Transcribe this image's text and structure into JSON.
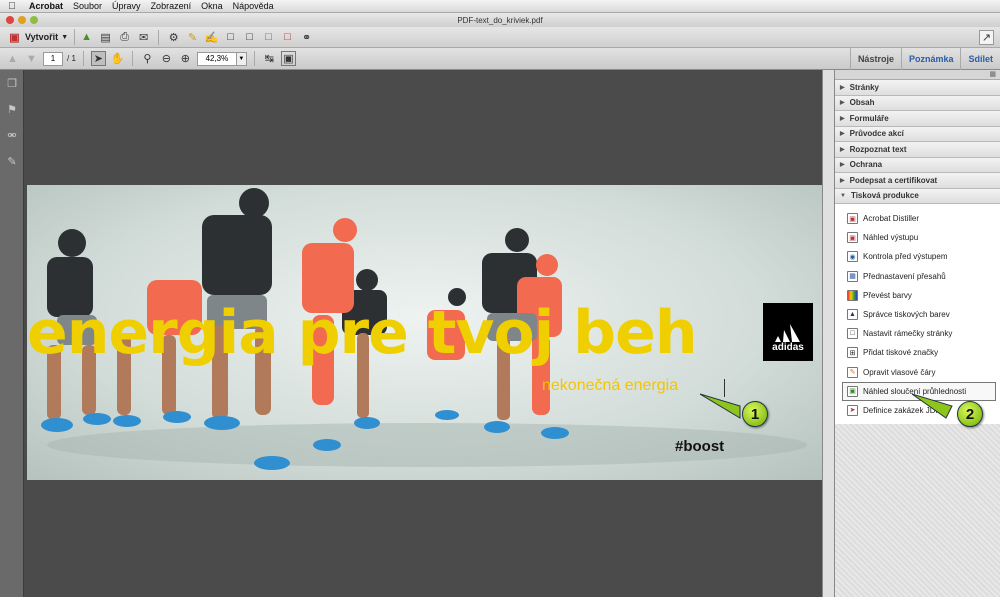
{
  "menubar": {
    "apple": "",
    "items": [
      "Acrobat",
      "Soubor",
      "Úpravy",
      "Zobrazení",
      "Okna",
      "Nápověda"
    ]
  },
  "window": {
    "title": "PDF-text_do_kriviek.pdf"
  },
  "toolbar": {
    "create_label": "Vytvořit",
    "page_current": "1",
    "page_total": "/ 1",
    "zoom_value": "42,3%"
  },
  "panel_tabs": [
    "Nástroje",
    "Poznámka",
    "Sdílet"
  ],
  "document": {
    "headline": "energia pre tvoj beh",
    "subline": "nekonečná energia",
    "hashtag": "#boost",
    "logo_text": "adidas"
  },
  "right_panel": {
    "sections": [
      "Stránky",
      "Obsah",
      "Formuláře",
      "Průvodce akcí",
      "Rozpoznat text",
      "Ochrana",
      "Podepsat a certifikovat"
    ],
    "expanded_section": "Tisková produkce",
    "tools": [
      "Acrobat Distiller",
      "Náhled výstupu",
      "Kontrola před výstupem",
      "Přednastavení přesahů",
      "Převést barvy",
      "Správce tiskových barev",
      "Nastavit rámečky stránky",
      "Přidat tiskové značky",
      "Opravit vlasové čáry",
      "Náhled sloučení průhlednosti",
      "Definice zakázek JDF"
    ]
  },
  "callouts": [
    "1",
    "2"
  ],
  "colors": {
    "accent": "#f0cf00",
    "callout": "#8ec51c",
    "tab_active": "#2a5da8"
  }
}
